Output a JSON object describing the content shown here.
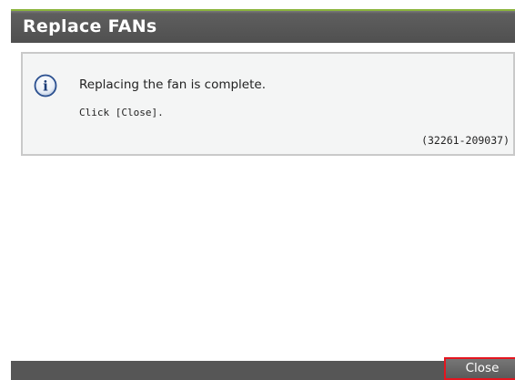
{
  "dialog": {
    "title": "Replace FANs"
  },
  "message": {
    "icon": "info-icon",
    "text": "Replacing the fan is complete.",
    "instruction": "Click [Close].",
    "code": "(32261-209037)"
  },
  "footer": {
    "close_label": "Close"
  },
  "colors": {
    "titlebar": "#4f4f4f",
    "accent_top": "#8ab43c",
    "close_highlight": "#e4151f",
    "info_icon": "#2a4f8f"
  }
}
